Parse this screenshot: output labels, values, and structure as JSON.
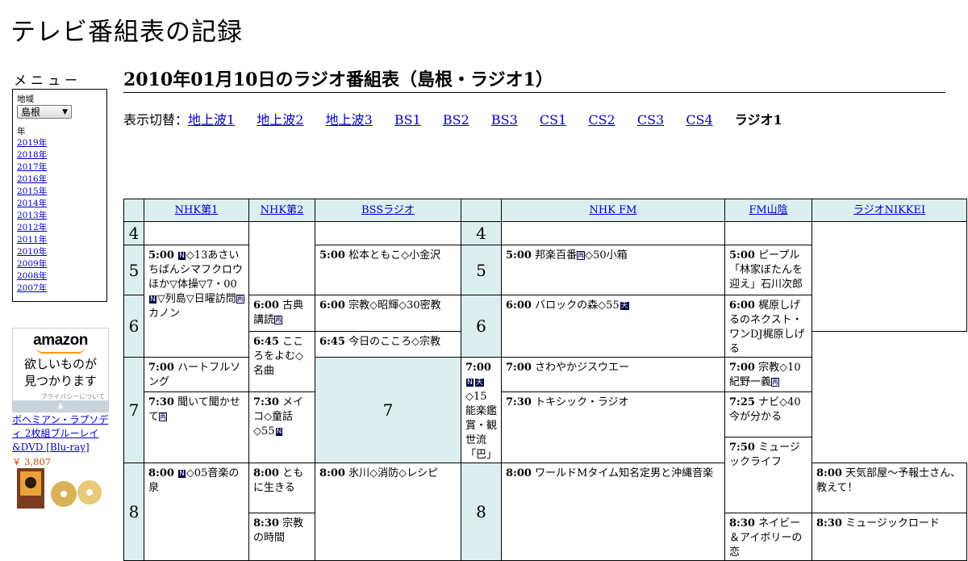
{
  "site_title": "テレビ番組表の記録",
  "menu": {
    "label": "メニュー",
    "region_label": "地域",
    "region_value": "島根",
    "year_label": "年",
    "years": [
      "2019年",
      "2018年",
      "2017年",
      "2016年",
      "2015年",
      "2014年",
      "2013年",
      "2012年",
      "2011年",
      "2010年",
      "2009年",
      "2008年",
      "2007年"
    ]
  },
  "ad": {
    "logo": "amazon",
    "slogan_line1": "欲しいものが",
    "slogan_line2": "見つかります",
    "privacy": "プライバシーについて",
    "product_name": "ボヘミアン・ラプソディ 2枚組ブルーレイ&DVD [Blu-ray]",
    "product_price": "￥ 3,807"
  },
  "page_title": "2010年01月10日のラジオ番組表（島根・ラジオ1）",
  "switch": {
    "label": "表示切替：",
    "links": [
      "地上波1",
      "地上波2",
      "地上波3",
      "BS1",
      "BS2",
      "BS3",
      "CS1",
      "CS2",
      "CS3",
      "CS4"
    ],
    "current": "ラジオ1"
  },
  "channels": [
    "NHK第1",
    "NHK第2",
    "BSSラジオ",
    "NHK FM",
    "FM山陰",
    "ラジオNIKKEI"
  ],
  "hours": [
    "4",
    "5",
    "6",
    "7",
    "8"
  ],
  "badges": {
    "n": "N",
    "re": "再",
    "tian": "天"
  },
  "programs": {
    "nhk1_500": {
      "time": "5:00",
      "a": "",
      "b": "◇13あさいちばんシマフクロウほか▽体操▽7・00",
      "c": "▽列島▽日曜訪問",
      "d": "カノン"
    },
    "nhk1_800": {
      "time": "8:00",
      "a": "",
      "b": "◇05音楽の泉"
    },
    "nhk2_600": {
      "time": "6:00",
      "title": "古典講読"
    },
    "nhk2_645": {
      "time": "6:45",
      "title": "こころをよむ◇名曲"
    },
    "nhk2_730": {
      "time": "7:30",
      "title": "聞いて聞かせて"
    },
    "nhk2_800": {
      "time": "8:00",
      "title": "ともに生きる"
    },
    "nhk2_830": {
      "time": "8:30",
      "title": "宗教の時間"
    },
    "bss_500": {
      "time": "5:00",
      "title": "松本ともこ◇小金沢"
    },
    "bss_600": {
      "time": "6:00",
      "title": "宗教◇昭輝◇30密教"
    },
    "bss_645": {
      "time": "6:45",
      "title": "今日のこころ◇宗教"
    },
    "bss_700": {
      "time": "7:00",
      "title": "ハートフルソング"
    },
    "bss_730": {
      "time": "7:30",
      "title": "メイコ◇童話◇55"
    },
    "bss_800": {
      "time": "8:00",
      "title": "氷川◇消防◇レシピ"
    },
    "fm_500": {
      "time": "5:00",
      "title": "邦楽百番",
      "rest": "◇50小箱"
    },
    "fm_600": {
      "time": "6:00",
      "title": "バロックの森◇55"
    },
    "fm_700": {
      "time": "7:00",
      "title": "◇15能楽鑑賞・観世流「巴」"
    },
    "fm_800": {
      "time": "8:00",
      "title": "ワールドMタイム知名定男と沖縄音楽"
    },
    "fms_500": {
      "time": "5:00",
      "title": "ピープル「林家ぼたんを迎え」石川次郎"
    },
    "fms_600": {
      "time": "6:00",
      "title": "梶原しげるのネクスト・ワンDJ梶原しげる"
    },
    "fms_700": {
      "time": "7:00",
      "title": "さわやかジスウエー"
    },
    "fms_730": {
      "time": "7:30",
      "title": "トキシック・ラジオ"
    },
    "fms_800": {
      "time": "8:00",
      "title": "天気部屋～予報士さん、教えて！"
    },
    "fms_830": {
      "time": "8:30",
      "title": "ネイビー＆アイボリーの恋"
    },
    "nik_700": {
      "time": "7:00",
      "title": "宗教◇10紀野一義"
    },
    "nik_725": {
      "time": "7:25",
      "title": "ナビ◇40今が分かる"
    },
    "nik_750": {
      "time": "7:50",
      "title": "ミュージックライフ"
    },
    "nik_830": {
      "time": "8:30",
      "title": "ミュージックロード"
    }
  }
}
